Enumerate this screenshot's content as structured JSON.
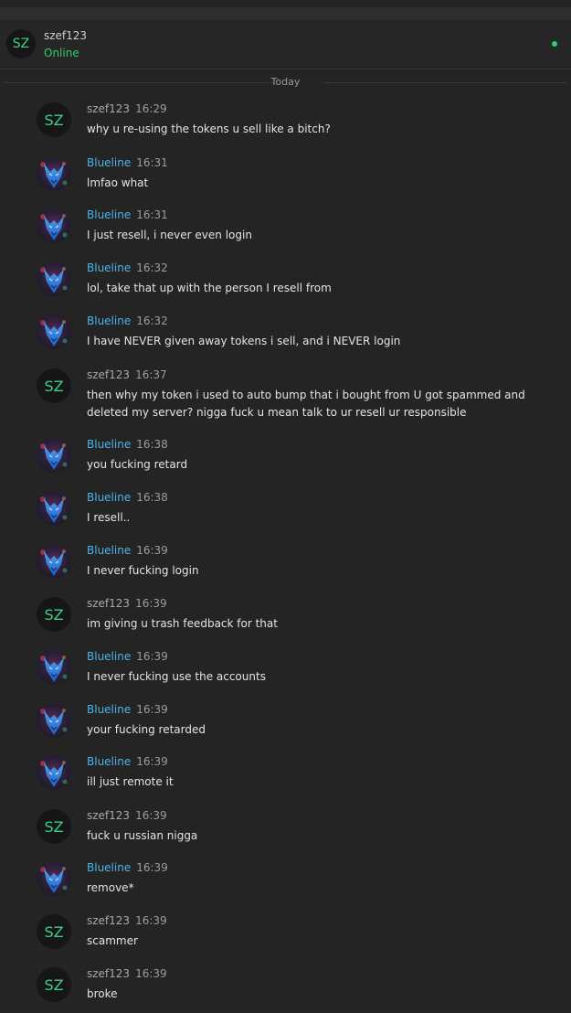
{
  "header": {
    "avatar_text": "SZ",
    "name": "szef123",
    "status": "Online"
  },
  "divider": {
    "label": "Today"
  },
  "colors": {
    "accent_blue": "#4bb3ea",
    "online_green": "#2fcf6c",
    "avatar_green": "#3fcf8a"
  },
  "messages": [
    {
      "author": "szef123",
      "time": "16:29",
      "text": "why u re-using the tokens u sell like a bitch?",
      "avatar": "SZ"
    },
    {
      "author": "Blueline",
      "time": "16:31",
      "text": "lmfao what",
      "avatar": "blue-wolf-icon"
    },
    {
      "author": "Blueline",
      "time": "16:31",
      "text": "I just resell, i never even login",
      "avatar": "blue-wolf-icon"
    },
    {
      "author": "Blueline",
      "time": "16:32",
      "text": "lol, take that up with the person I resell from",
      "avatar": "blue-wolf-icon"
    },
    {
      "author": "Blueline",
      "time": "16:32",
      "text": "I have NEVER given away tokens i sell, and i NEVER login",
      "avatar": "blue-wolf-icon"
    },
    {
      "author": "szef123",
      "time": "16:37",
      "text": "then why my token i used to auto bump that i bought from U got spammed and deleted my server? nigga fuck u mean talk to ur resell ur responsible",
      "avatar": "SZ"
    },
    {
      "author": "Blueline",
      "time": "16:38",
      "text": "you fucking retard",
      "avatar": "blue-wolf-icon"
    },
    {
      "author": "Blueline",
      "time": "16:38",
      "text": "I resell..",
      "avatar": "blue-wolf-icon"
    },
    {
      "author": "Blueline",
      "time": "16:39",
      "text": "I never fucking login",
      "avatar": "blue-wolf-icon"
    },
    {
      "author": "szef123",
      "time": "16:39",
      "text": "im giving u trash feedback for that",
      "avatar": "SZ"
    },
    {
      "author": "Blueline",
      "time": "16:39",
      "text": "I never fucking use the accounts",
      "avatar": "blue-wolf-icon"
    },
    {
      "author": "Blueline",
      "time": "16:39",
      "text": "your fucking retarded",
      "avatar": "blue-wolf-icon"
    },
    {
      "author": "Blueline",
      "time": "16:39",
      "text": "ill just remote it",
      "avatar": "blue-wolf-icon"
    },
    {
      "author": "szef123",
      "time": "16:39",
      "text": "fuck u russian nigga",
      "avatar": "SZ"
    },
    {
      "author": "Blueline",
      "time": "16:39",
      "text": "remove*",
      "avatar": "blue-wolf-icon"
    },
    {
      "author": "szef123",
      "time": "16:39",
      "text": "scammer",
      "avatar": "SZ"
    },
    {
      "author": "szef123",
      "time": "16:39",
      "text": "broke",
      "avatar": "SZ"
    }
  ]
}
